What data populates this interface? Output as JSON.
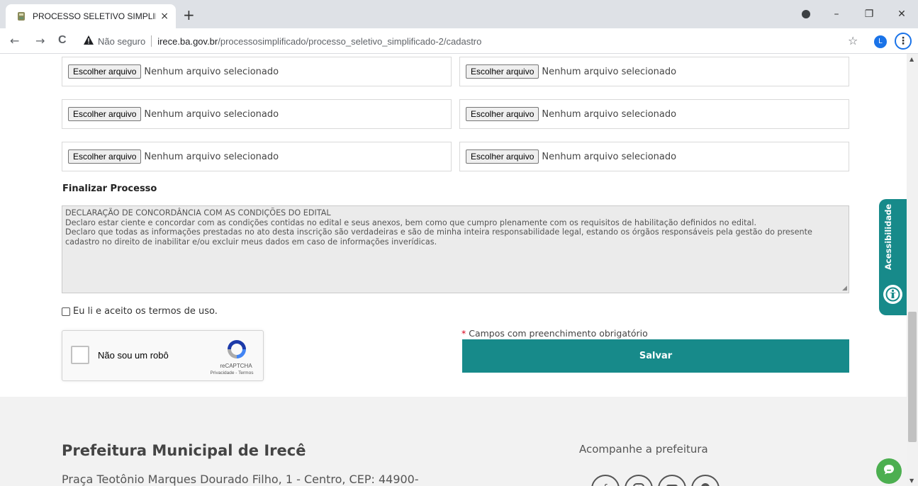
{
  "browser": {
    "tab_title": "PROCESSO SELETIVO SIMPLIFICA",
    "tab_close": "×",
    "new_tab": "+",
    "back": "←",
    "forward": "→",
    "reload": "C",
    "security_label": "Não seguro",
    "url_host": "irece.ba.gov.br",
    "url_path": "/processosimplificado/processo_seletivo_simplificado-2/cadastro",
    "profile_initial": "L",
    "menu": "⋮",
    "bookmark_star": "☆",
    "minimize": "–",
    "restore": "❐",
    "close": "✕"
  },
  "file_inputs": [
    {
      "button": "Escolher arquivo",
      "status": "Nenhum arquivo selecionado"
    },
    {
      "button": "Escolher arquivo",
      "status": "Nenhum arquivo selecionado"
    },
    {
      "button": "Escolher arquivo",
      "status": "Nenhum arquivo selecionado"
    },
    {
      "button": "Escolher arquivo",
      "status": "Nenhum arquivo selecionado"
    },
    {
      "button": "Escolher arquivo",
      "status": "Nenhum arquivo selecionado"
    },
    {
      "button": "Escolher arquivo",
      "status": "Nenhum arquivo selecionado"
    }
  ],
  "finalize": {
    "title": "Finalizar Processo",
    "terms_lines": [
      "DECLARAÇÃO DE CONCORDÂNCIA COM AS CONDIÇÕES DO EDITAL",
      "Declaro estar ciente e concordar com as condições contidas no edital e seus anexos, bem como que cumpro plenamente com os requisitos de habilitação definidos no edital.",
      "Declaro que todas as informações prestadas no ato desta inscrição são verdadeiras e são de minha inteira responsabilidade legal, estando os órgãos responsáveis pela gestão do presente cadastro no direito de inabilitar e/ou excluir meus dados em caso de informações inverídicas."
    ],
    "accept_label": "Eu li e aceito os termos de uso.",
    "accept_checked": false
  },
  "captcha": {
    "label": "Não sou um robô",
    "brand": "reCAPTCHA",
    "links": "Privacidade - Termos"
  },
  "form": {
    "required_asterisk": "*",
    "required_note": " Campos com preenchimento obrigatório",
    "save_label": "Salvar"
  },
  "footer": {
    "org_name": "Prefeitura Municipal de Irecê",
    "address": "Praça Teotônio Marques Dourado Filho, 1 - Centro, CEP: 44900-",
    "follow_label": "Acompanhe a prefeitura",
    "social_icons": [
      "facebook-icon",
      "instagram-icon",
      "youtube-icon",
      "location-icon"
    ]
  },
  "accessibility": {
    "label": "Acessibilidade"
  },
  "colors": {
    "accent": "#178a8a",
    "footer_bg": "#f2f2f2",
    "required": "#d9001b",
    "chat": "#4caf50"
  }
}
